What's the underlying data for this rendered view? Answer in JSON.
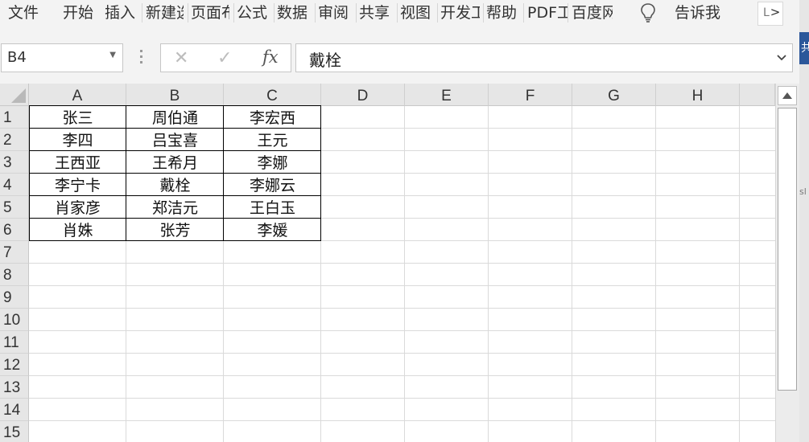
{
  "ribbon": {
    "tabs": [
      "文件",
      "开始",
      "插入",
      "新建选项卡",
      "页面布局",
      "公式",
      "数据",
      "审阅",
      "共享",
      "视图",
      "开发工具",
      "帮助",
      "PDF工具集",
      "百度网盘"
    ],
    "tell_me": "告诉我",
    "scroll_left_glyph": "L",
    "scroll_right_glyph": ">"
  },
  "edge_glyphs": {
    "blue": "共",
    "mark": "sl"
  },
  "formula_bar": {
    "name_box": "B4",
    "cancel_glyph": "✕",
    "enter_glyph": "✓",
    "fx_label": "fx",
    "content": "戴栓"
  },
  "columns": [
    "A",
    "B",
    "C",
    "D",
    "E",
    "F",
    "G",
    "H"
  ],
  "rows": [
    "1",
    "2",
    "3",
    "4",
    "5",
    "6",
    "7",
    "8",
    "9",
    "10",
    "11",
    "12",
    "13",
    "14",
    "15"
  ],
  "table": [
    [
      "张三",
      "周伯通",
      "李宏西"
    ],
    [
      "李四",
      "吕宝喜",
      "王元"
    ],
    [
      "王西亚",
      "王希月",
      "李娜"
    ],
    [
      "李宁卡",
      "戴栓",
      "李娜云"
    ],
    [
      "肖家彦",
      "郑洁元",
      "王白玉"
    ],
    [
      "肖姝",
      "张芳",
      "李媛"
    ]
  ],
  "colors": {
    "ribbon_bg": "#f3f3f3",
    "header_bg": "#e6e6e6",
    "gridline": "#dadada",
    "brand": "#2b579a"
  }
}
